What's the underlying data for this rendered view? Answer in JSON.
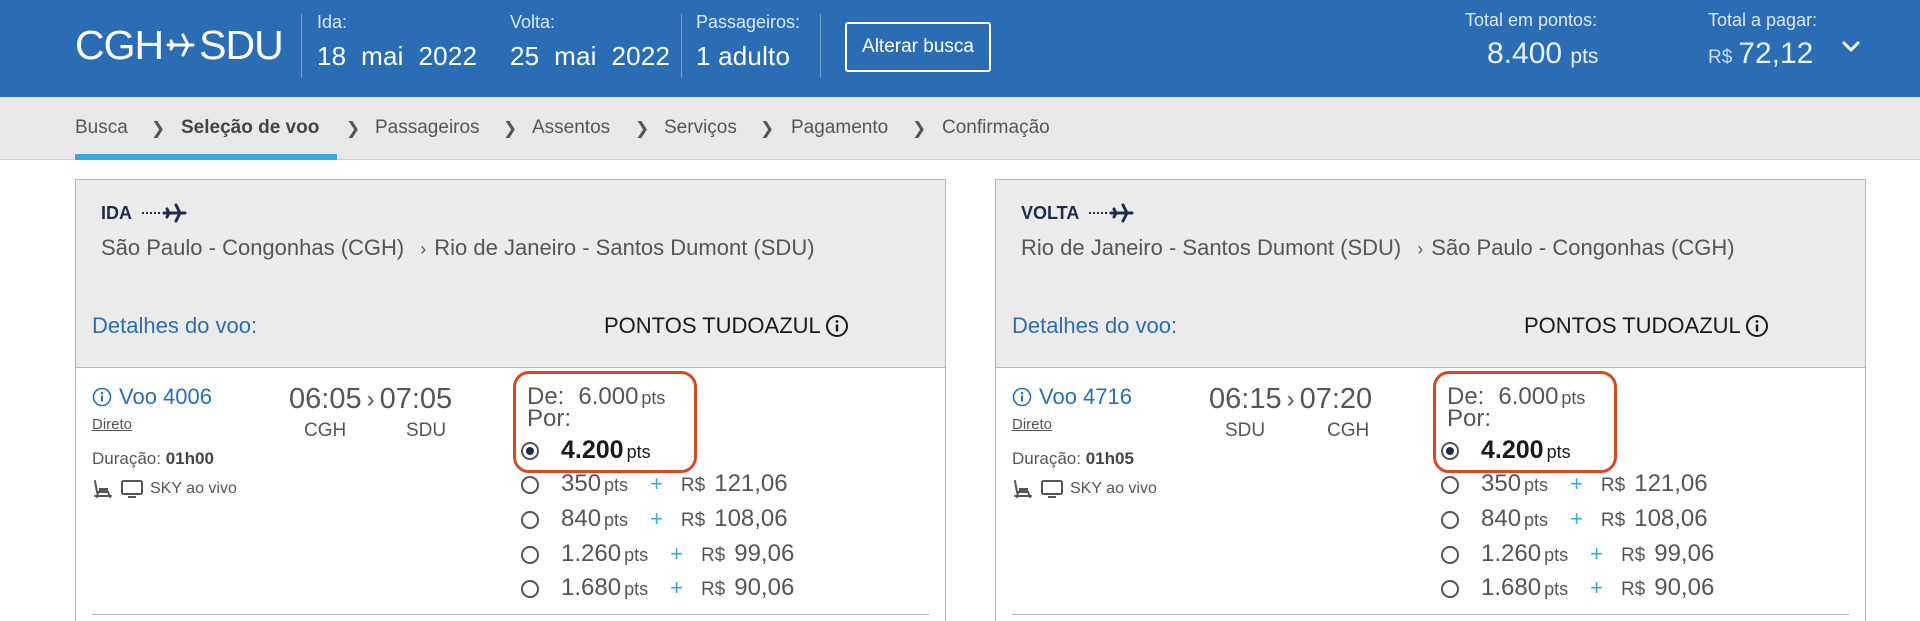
{
  "header": {
    "origin": "CGH",
    "destination": "SDU",
    "ida_label": "Ida:",
    "ida_value": "18  mai  2022",
    "volta_label": "Volta:",
    "volta_value": "25  mai  2022",
    "passageiros_label": "Passageiros:",
    "passageiros_value": "1 adulto",
    "alterar_button": "Alterar busca",
    "total_pontos_label": "Total em pontos:",
    "total_pontos_value": "8.400",
    "total_pontos_unit": "pts",
    "total_pagar_label": "Total a pagar:",
    "total_pagar_currency": "R$",
    "total_pagar_value": "72,12",
    "background_color": "#2a6db5"
  },
  "breadcrumb": {
    "steps": [
      "Busca",
      "Seleção de voo",
      "Passageiros",
      "Assentos",
      "Serviços",
      "Pagamento",
      "Confirmação"
    ],
    "active_index": 1,
    "accent_color": "#3ea7d8"
  },
  "flights": [
    {
      "direction": "IDA",
      "from": "São Paulo - Congonhas (CGH)",
      "to": "Rio de Janeiro - Santos Dumont (SDU)",
      "details_label": "Detalhes do voo:",
      "pontos_label": "PONTOS TUDOAZUL",
      "flight_number": "Voo 4006",
      "stop_type": "Direto",
      "duration_label": "Duração:",
      "duration_value": "01h00",
      "amenity_label": "SKY ao vivo",
      "depart_time": "06:05",
      "arrive_time": "07:05",
      "depart_airport": "CGH",
      "arrive_airport": "SDU",
      "de_label": "De:",
      "de_value": "6.000",
      "por_label": "Por:",
      "selected_points": "4.200",
      "points_unit": "pts",
      "options": [
        {
          "points": "350",
          "currency": "R$",
          "amount": "121,06"
        },
        {
          "points": "840",
          "currency": "R$",
          "amount": "108,06"
        },
        {
          "points": "1.260",
          "currency": "R$",
          "amount": "99,06"
        },
        {
          "points": "1.680",
          "currency": "R$",
          "amount": "90,06"
        }
      ]
    },
    {
      "direction": "VOLTA",
      "from": "Rio de Janeiro - Santos Dumont (SDU)",
      "to": "São Paulo - Congonhas (CGH)",
      "details_label": "Detalhes do voo:",
      "pontos_label": "PONTOS TUDOAZUL",
      "flight_number": "Voo 4716",
      "stop_type": "Direto",
      "duration_label": "Duração:",
      "duration_value": "01h05",
      "amenity_label": "SKY ao vivo",
      "depart_time": "06:15",
      "arrive_time": "07:20",
      "depart_airport": "SDU",
      "arrive_airport": "CGH",
      "de_label": "De:",
      "de_value": "6.000",
      "por_label": "Por:",
      "selected_points": "4.200",
      "points_unit": "pts",
      "options": [
        {
          "points": "350",
          "currency": "R$",
          "amount": "121,06"
        },
        {
          "points": "840",
          "currency": "R$",
          "amount": "108,06"
        },
        {
          "points": "1.260",
          "currency": "R$",
          "amount": "99,06"
        },
        {
          "points": "1.680",
          "currency": "R$",
          "amount": "90,06"
        }
      ]
    }
  ],
  "highlight_color": "#d24a28"
}
